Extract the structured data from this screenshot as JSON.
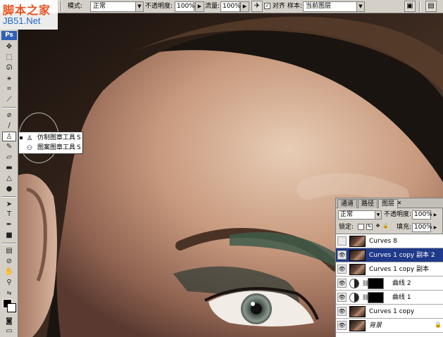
{
  "watermark": {
    "line1": "脚本之家",
    "line2": "JB51.Net"
  },
  "options_bar": {
    "mode_label": "模式:",
    "mode_value": "正常",
    "opacity_label": "不透明度:",
    "opacity_value": "100%",
    "flow_label": "流量:",
    "flow_value": "100%",
    "aligned_label": "对齐",
    "sample_label": "样本:",
    "sample_value": "当前图层"
  },
  "toolbox": {
    "logo": "Ps"
  },
  "flyout": {
    "items": [
      {
        "label": "仿制图章工具",
        "shortcut": "S",
        "icon": "clone-stamp-icon"
      },
      {
        "label": "图案图章工具",
        "shortcut": "S",
        "icon": "pattern-stamp-icon"
      }
    ]
  },
  "layers_panel": {
    "tabs": [
      "通道",
      "路径",
      "图层"
    ],
    "active_tab": "图层",
    "blend_mode": "正常",
    "opacity_label": "不透明度:",
    "opacity_value": "100%",
    "lock_label": "锁定:",
    "fill_label": "填充:",
    "fill_value": "100%",
    "layers": [
      {
        "name": "Curves 8",
        "visible": false,
        "selected": false,
        "type": "image"
      },
      {
        "name": "Curves 1 copy 副本 2",
        "visible": true,
        "selected": true,
        "type": "image"
      },
      {
        "name": "Curves 1 copy 副本",
        "visible": true,
        "selected": false,
        "type": "image"
      },
      {
        "name": "曲线 2",
        "visible": true,
        "selected": false,
        "type": "adjustment"
      },
      {
        "name": "曲线 1",
        "visible": true,
        "selected": false,
        "type": "adjustment"
      },
      {
        "name": "Curves 1 copy",
        "visible": true,
        "selected": false,
        "type": "image"
      },
      {
        "name": "背景",
        "visible": true,
        "selected": false,
        "type": "background"
      }
    ]
  }
}
